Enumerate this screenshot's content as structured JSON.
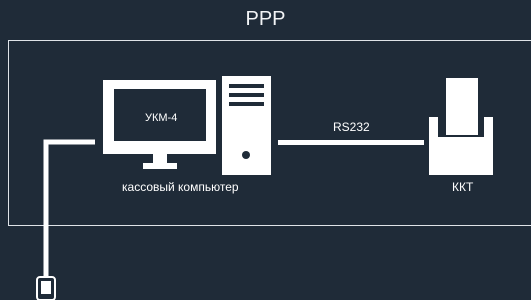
{
  "diagram": {
    "title": "PPP",
    "terminal_label": "УКМ-4",
    "computer_label": "кассовый компьютер",
    "link_label": "RS232",
    "printer_label": "ККТ",
    "icons": [
      "monitor-icon",
      "system-unit-icon",
      "fiscal-printer-icon",
      "mobile-device-icon"
    ]
  }
}
